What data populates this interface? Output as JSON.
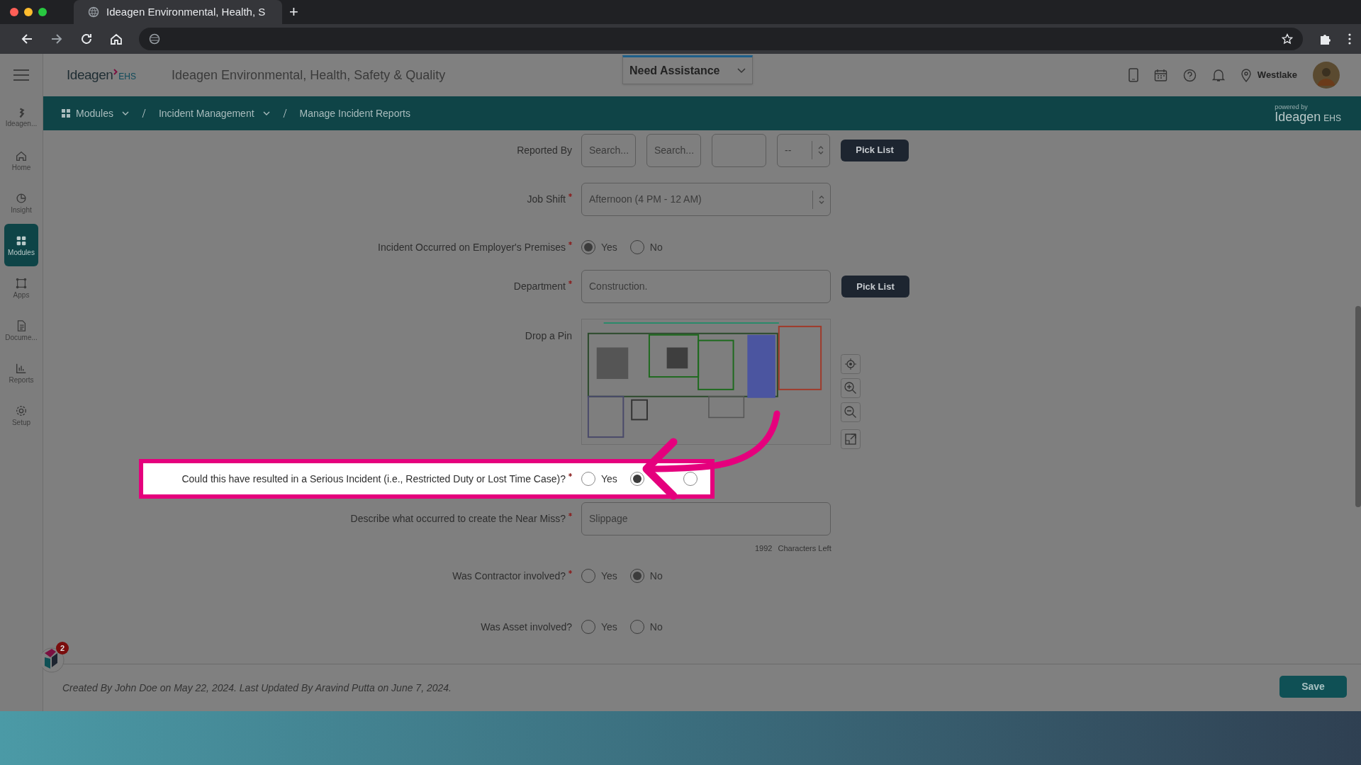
{
  "browser": {
    "tab_title": "Ideagen Environmental, Health, S",
    "new_tab": "+"
  },
  "header": {
    "logo": "Ideagen",
    "logo_suffix": "EHS",
    "title": "Ideagen Environmental, Health, Safety & Quality",
    "assistance": "Need Assistance",
    "user": "Westlake"
  },
  "sidebar": {
    "items": [
      {
        "label": "Ideagen...",
        "kind": "brand",
        "selected": false
      },
      {
        "label": "Home",
        "kind": "home",
        "selected": false
      },
      {
        "label": "Insight",
        "kind": "insight",
        "selected": false
      },
      {
        "label": "Modules",
        "kind": "modules",
        "selected": true
      },
      {
        "label": "Apps",
        "kind": "apps",
        "selected": false
      },
      {
        "label": "Docume...",
        "kind": "document",
        "selected": false
      },
      {
        "label": "Reports",
        "kind": "reports",
        "selected": false
      },
      {
        "label": "Setup",
        "kind": "setup",
        "selected": false
      }
    ]
  },
  "breadcrumb": [
    {
      "label": "Modules",
      "dropdown": true
    },
    {
      "label": "Incident Management",
      "dropdown": true
    },
    {
      "label": "Manage Incident Reports",
      "dropdown": false
    }
  ],
  "powered_by": {
    "caption": "powered by",
    "logo": "Ideagen",
    "suffix": "EHS"
  },
  "form": [
    {
      "kind": "picker",
      "label": "Reported By",
      "required": false,
      "inputs": [
        {
          "kind": "search",
          "placeholder": "Search..."
        },
        {
          "kind": "search",
          "placeholder": "Search..."
        },
        {
          "kind": "blank"
        }
      ],
      "select": "--",
      "button": "Pick List"
    },
    {
      "kind": "select",
      "label": "Job Shift",
      "required": true,
      "value": "Afternoon (4 PM - 12 AM)"
    },
    {
      "kind": "radio",
      "label": "Incident Occurred on Employer's Premises",
      "required": true,
      "options": [
        {
          "label": "Yes",
          "selected": true
        },
        {
          "label": "No",
          "selected": false
        }
      ]
    },
    {
      "kind": "text",
      "label": "Department",
      "required": true,
      "value": "Construction.",
      "button": "Pick List"
    },
    {
      "kind": "map",
      "label": "Drop a Pin",
      "required": false
    },
    {
      "kind": "radio",
      "label": "Could this have resulted in a Serious Incident (i.e., Restricted Duty or Lost Time Case)?",
      "required": true,
      "highlighted": true,
      "options": [
        {
          "label": "Yes",
          "selected": false
        },
        {
          "selected": true
        },
        {
          "selected": false
        }
      ]
    },
    {
      "kind": "textarea",
      "label": "Describe what occurred to create the Near Miss?",
      "required": true,
      "value": "Slippage",
      "counter": "1992",
      "counter_label": "Characters Left"
    },
    {
      "kind": "radio",
      "label": "Was Contractor involved?",
      "required": true,
      "options": [
        {
          "label": "Yes",
          "selected": false
        },
        {
          "label": "No",
          "selected": true
        }
      ]
    },
    {
      "kind": "radio",
      "label": "Was Asset involved?",
      "required": false,
      "options": [
        {
          "label": "Yes",
          "selected": false
        },
        {
          "label": "No",
          "selected": false
        }
      ]
    }
  ],
  "annotation": {
    "kind": "arrow"
  },
  "widget": {
    "badge": "2"
  },
  "footer": {
    "audit": "Created By John Doe on May 22, 2024. Last Updated By Aravind Putta on June 7, 2024.",
    "save": "Save"
  }
}
